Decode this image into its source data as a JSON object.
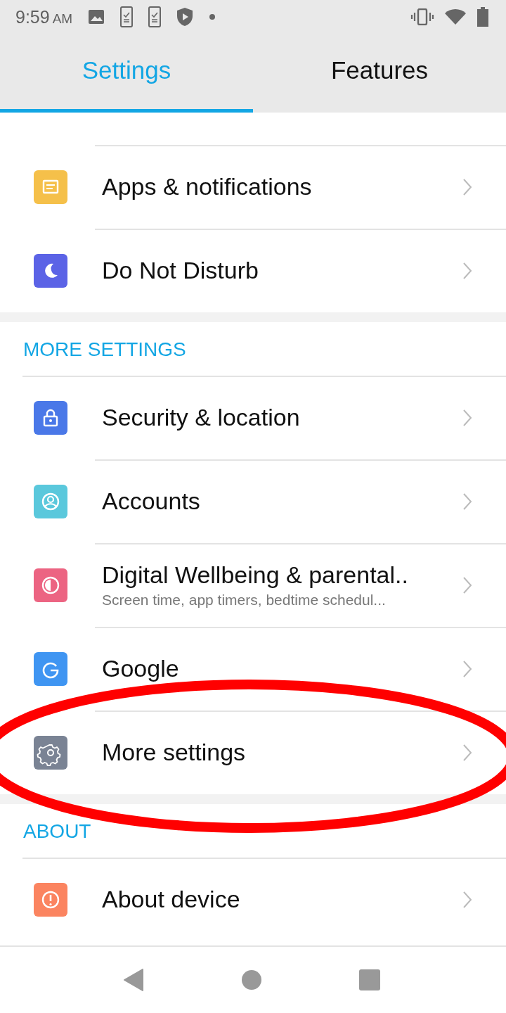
{
  "status_bar": {
    "time": "9:59",
    "meridiem": "AM"
  },
  "tabs": [
    {
      "label": "Settings",
      "selected": true
    },
    {
      "label": "Features",
      "selected": false
    }
  ],
  "sections": [
    {
      "items": [
        {
          "kind": "message",
          "color": "#f5c04a",
          "title": "Apps & notifications"
        },
        {
          "kind": "moon",
          "color": "#5b63e6",
          "title": "Do Not Disturb"
        }
      ]
    },
    {
      "header": "MORE SETTINGS",
      "items": [
        {
          "kind": "lock",
          "color": "#4a78e8",
          "title": "Security & location"
        },
        {
          "kind": "person",
          "color": "#5ac8dc",
          "title": "Accounts"
        },
        {
          "kind": "halfcircle",
          "color": "#ec6482",
          "title": "Digital Wellbeing & parental..",
          "subtitle": "Screen time, app timers, bedtime schedul..."
        },
        {
          "kind": "google",
          "color": "#3f95f2",
          "title": "Google"
        },
        {
          "kind": "gear",
          "color": "#7a8394",
          "title": "More settings"
        }
      ]
    },
    {
      "header": "ABOUT",
      "items": [
        {
          "kind": "alert",
          "color": "#fb8460",
          "title": "About device"
        }
      ]
    }
  ]
}
